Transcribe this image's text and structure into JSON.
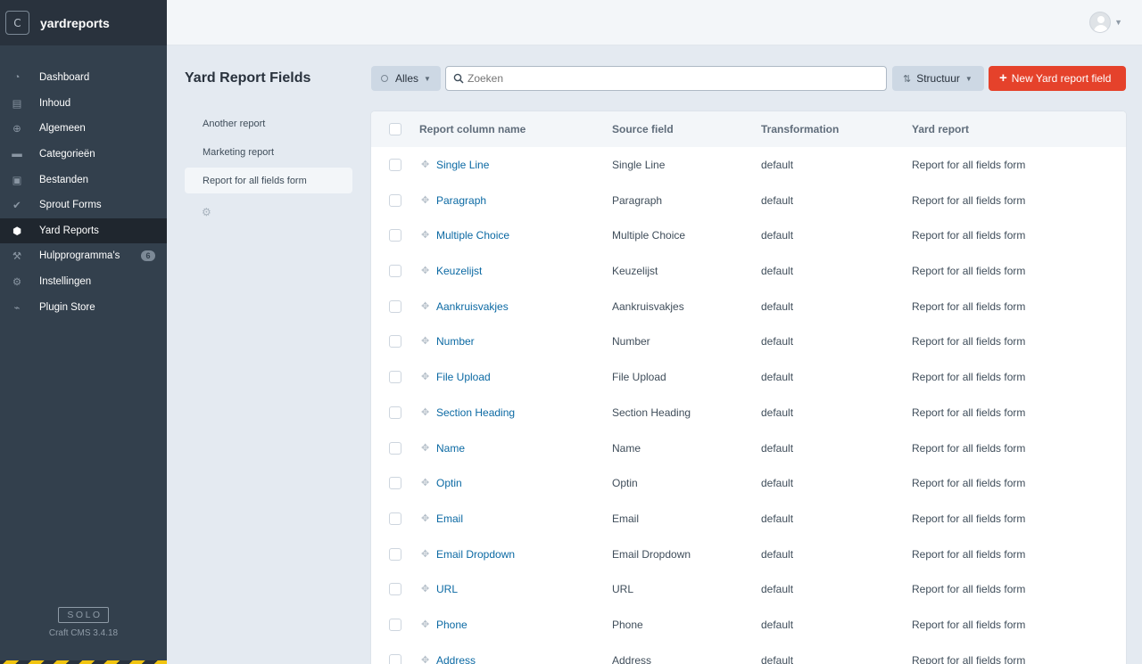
{
  "site": {
    "icon_letter": "C",
    "name": "yardreports"
  },
  "nav": [
    {
      "label": "Dashboard",
      "icon": "gauge-icon",
      "glyph": "◔"
    },
    {
      "label": "Inhoud",
      "icon": "newspaper-icon",
      "glyph": "▤"
    },
    {
      "label": "Algemeen",
      "icon": "globe-icon",
      "glyph": "⊕"
    },
    {
      "label": "Categorieën",
      "icon": "folder-icon",
      "glyph": "▬"
    },
    {
      "label": "Bestanden",
      "icon": "image-icon",
      "glyph": "▣"
    },
    {
      "label": "Sprout Forms",
      "icon": "check-icon",
      "glyph": "✔"
    },
    {
      "label": "Yard Reports",
      "icon": "hexagon-icon",
      "glyph": "⬢",
      "selected": true
    },
    {
      "label": "Hulpprogramma's",
      "icon": "wrench-icon",
      "glyph": "⚒",
      "badge": "6"
    },
    {
      "label": "Instellingen",
      "icon": "gear-icon",
      "glyph": "⚙"
    },
    {
      "label": "Plugin Store",
      "icon": "plug-icon",
      "glyph": "⌁"
    }
  ],
  "edition": {
    "label": "SOLO",
    "version": "Craft CMS 3.4.18"
  },
  "page": {
    "title": "Yard Report Fields"
  },
  "sources": [
    {
      "label": "Another report"
    },
    {
      "label": "Marketing report"
    },
    {
      "label": "Report for all fields form",
      "selected": true
    }
  ],
  "toolbar": {
    "status_label": "Alles",
    "search_placeholder": "Zoeken",
    "sort_label": "Structuur",
    "new_label": "New Yard report field"
  },
  "colors": {
    "accent": "#e5422b",
    "link": "#0b69a3",
    "sidebar": "#33404d"
  },
  "table": {
    "columns": [
      "Report column name",
      "Source field",
      "Transformation",
      "Yard report"
    ],
    "rows": [
      [
        "Single Line",
        "Single Line",
        "default",
        "Report for all fields form"
      ],
      [
        "Paragraph",
        "Paragraph",
        "default",
        "Report for all fields form"
      ],
      [
        "Multiple Choice",
        "Multiple Choice",
        "default",
        "Report for all fields form"
      ],
      [
        "Keuzelijst",
        "Keuzelijst",
        "default",
        "Report for all fields form"
      ],
      [
        "Aankruisvakjes",
        "Aankruisvakjes",
        "default",
        "Report for all fields form"
      ],
      [
        "Number",
        "Number",
        "default",
        "Report for all fields form"
      ],
      [
        "File Upload",
        "File Upload",
        "default",
        "Report for all fields form"
      ],
      [
        "Section Heading",
        "Section Heading",
        "default",
        "Report for all fields form"
      ],
      [
        "Name",
        "Name",
        "default",
        "Report for all fields form"
      ],
      [
        "Optin",
        "Optin",
        "default",
        "Report for all fields form"
      ],
      [
        "Email",
        "Email",
        "default",
        "Report for all fields form"
      ],
      [
        "Email Dropdown",
        "Email Dropdown",
        "default",
        "Report for all fields form"
      ],
      [
        "URL",
        "URL",
        "default",
        "Report for all fields form"
      ],
      [
        "Phone",
        "Phone",
        "default",
        "Report for all fields form"
      ],
      [
        "Address",
        "Address",
        "default",
        "Report for all fields form"
      ]
    ]
  }
}
